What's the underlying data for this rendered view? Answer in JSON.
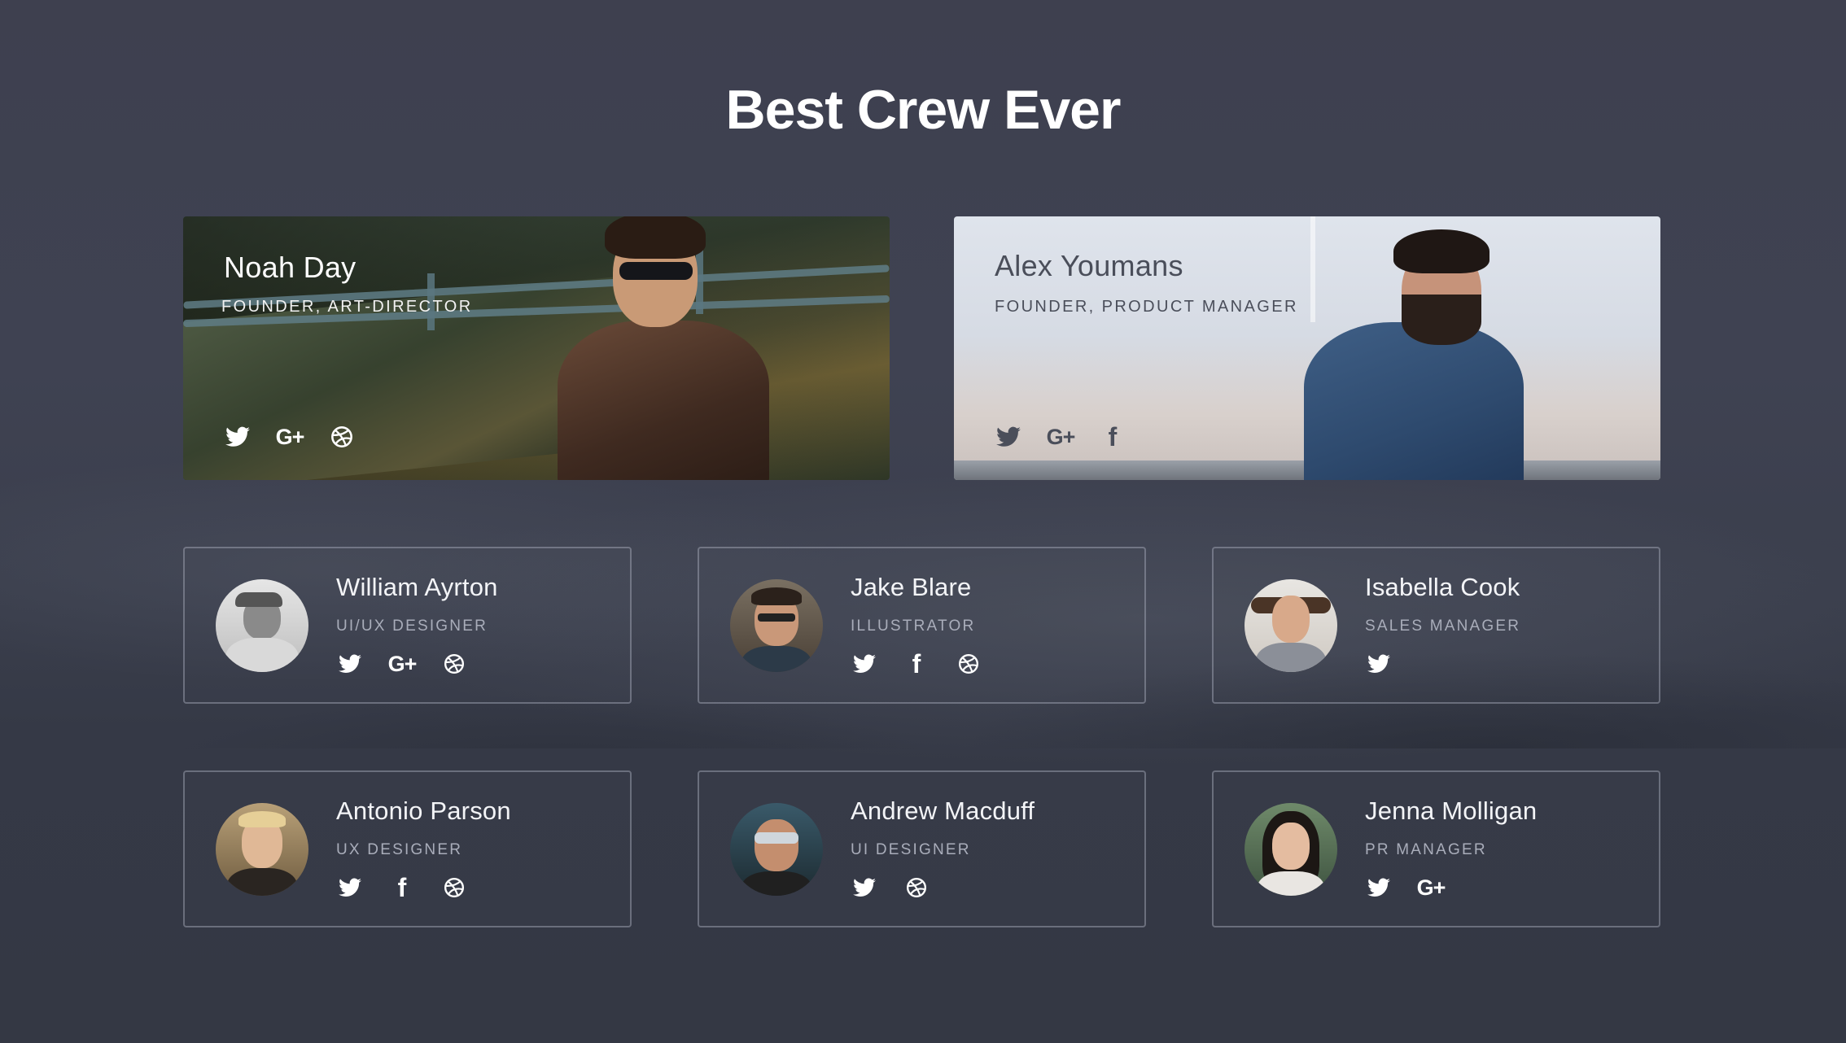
{
  "header": {
    "title": "Best Crew Ever"
  },
  "featured": [
    {
      "name": "Noah Day",
      "role": "FOUNDER, ART-DIRECTOR",
      "socials": [
        "twitter-icon",
        "google-plus-icon",
        "dribbble-icon"
      ],
      "text_color": "#ffffff"
    },
    {
      "name": "Alex Youmans",
      "role": "FOUNDER, PRODUCT MANAGER",
      "socials": [
        "twitter-icon",
        "google-plus-icon",
        "facebook-icon"
      ],
      "text_color": "#4a4e5a"
    }
  ],
  "members": [
    {
      "name": "William Ayrton",
      "role": "UI/UX DESIGNER",
      "socials": [
        "twitter-icon",
        "google-plus-icon",
        "dribbble-icon"
      ]
    },
    {
      "name": "Jake Blare",
      "role": "ILLUSTRATOR",
      "socials": [
        "twitter-icon",
        "facebook-icon",
        "dribbble-icon"
      ]
    },
    {
      "name": "Isabella Cook",
      "role": "SALES MANAGER",
      "socials": [
        "twitter-icon"
      ]
    },
    {
      "name": "Antonio Parson",
      "role": "UX DESIGNER",
      "socials": [
        "twitter-icon",
        "facebook-icon",
        "dribbble-icon"
      ]
    },
    {
      "name": "Andrew Macduff",
      "role": "UI DESIGNER",
      "socials": [
        "twitter-icon",
        "dribbble-icon"
      ]
    },
    {
      "name": "Jenna Molligan",
      "role": "PR MANAGER",
      "socials": [
        "twitter-icon",
        "google-plus-icon"
      ]
    }
  ],
  "icon_glyphs": {
    "google-plus-icon": "G+",
    "facebook-icon": "f"
  },
  "colors": {
    "background": "#3e404f",
    "card_border": "#aab0be",
    "role_text": "#a9adba"
  }
}
